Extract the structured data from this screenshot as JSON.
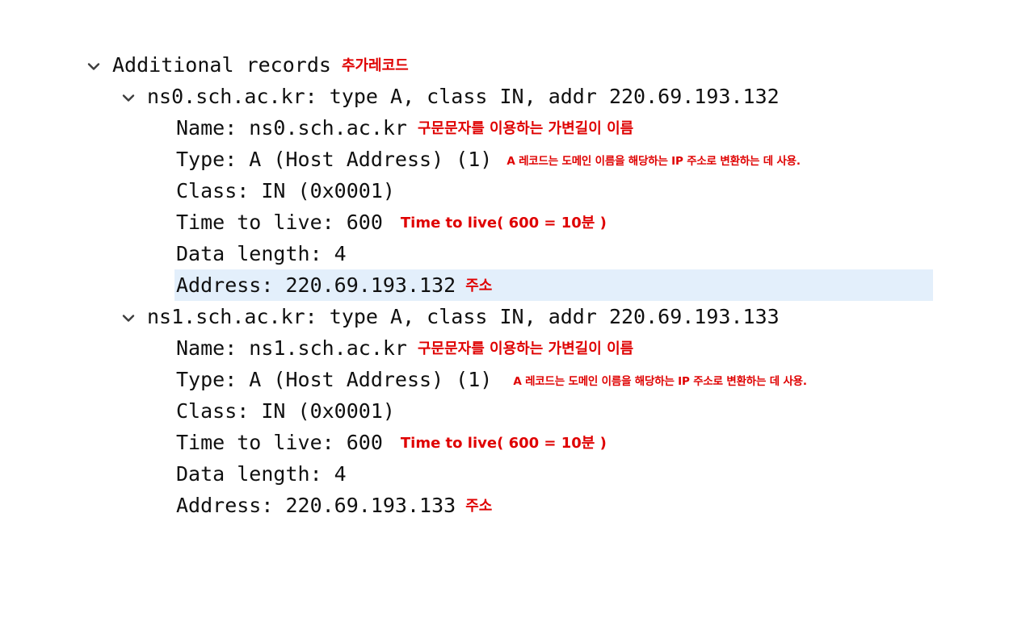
{
  "colors": {
    "background": "#ffffff",
    "tree_text": "#101010",
    "annotation_red": "#df0000",
    "selected_row": "#e3effb",
    "chevron": "#3c3c3c"
  },
  "tree": {
    "root": {
      "label": "Additional records",
      "annotation": "추가레코드",
      "chevron_icon": "chevron-down-icon",
      "expanded": true
    },
    "records": [
      {
        "header": "ns0.sch.ac.kr: type A, class IN, addr 220.69.193.132",
        "chevron_icon": "chevron-down-icon",
        "expanded": true,
        "fields": [
          {
            "label": "Name: ns0.sch.ac.kr",
            "annotation": "구문문자를 이용하는 가변길이 이름",
            "annotation_size": "large",
            "selected": false
          },
          {
            "label": "Type: A (Host Address) (1)",
            "annotation": "A 레코드는 도메인 이름을 해당하는 IP 주소로 변환하는 데 사용.",
            "annotation_size": "small",
            "selected": false
          },
          {
            "label": "Class: IN (0x0001)",
            "annotation": "",
            "annotation_size": "large",
            "selected": false
          },
          {
            "label": "Time to live: 600",
            "annotation": "Time to live( 600 = 10분 )",
            "annotation_size": "large",
            "selected": false
          },
          {
            "label": "Data length: 4",
            "annotation": "",
            "annotation_size": "large",
            "selected": false
          },
          {
            "label": "Address: 220.69.193.132",
            "annotation": "주소",
            "annotation_size": "large",
            "selected": true
          }
        ]
      },
      {
        "header": "ns1.sch.ac.kr: type A, class IN, addr 220.69.193.133",
        "chevron_icon": "chevron-down-icon",
        "expanded": true,
        "fields": [
          {
            "label": "Name: ns1.sch.ac.kr",
            "annotation": "구문문자를 이용하는 가변길이 이름",
            "annotation_size": "large",
            "selected": false
          },
          {
            "label": "Type: A (Host Address) (1)",
            "annotation": "A 레코드는 도메인 이름을 해당하는 IP 주소로 변환하는 데 사용.",
            "annotation_size": "small",
            "selected": false
          },
          {
            "label": "Class: IN (0x0001)",
            "annotation": "",
            "annotation_size": "large",
            "selected": false
          },
          {
            "label": "Time to live: 600",
            "annotation": "Time to live( 600 = 10분 )",
            "annotation_size": "large",
            "selected": false
          },
          {
            "label": "Data length: 4",
            "annotation": "",
            "annotation_size": "large",
            "selected": false
          },
          {
            "label": "Address: 220.69.193.133",
            "annotation": "주소",
            "annotation_size": "large",
            "selected": false
          }
        ]
      }
    ]
  }
}
